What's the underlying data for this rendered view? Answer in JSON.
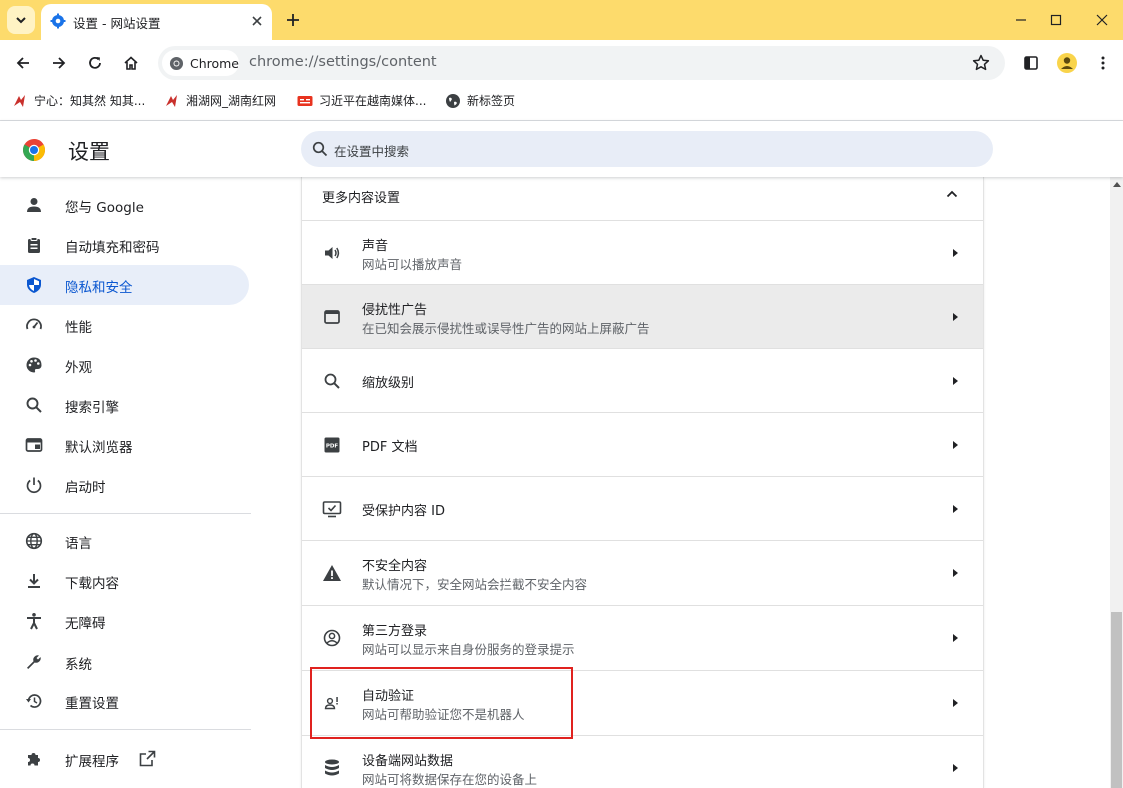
{
  "colors": {
    "tabstrip": "#fddb6c",
    "accent_blue": "#0b57d0",
    "sidebar_active_bg": "#e8eef9",
    "search_bg": "#e8edf7",
    "highlight_red": "#e0221f"
  },
  "tab": {
    "title": "设置 - 网站设置",
    "favicon": "gear-icon"
  },
  "toolbar": {
    "chip_label": "Chrome",
    "url_scheme": "chrome://",
    "url_host": "settings",
    "url_path": "/content"
  },
  "bookmarks": [
    {
      "label": "宁心：知其然 知其...",
      "icon": "red-bookmark-icon"
    },
    {
      "label": "湘湖网_湖南红网",
      "icon": "red-bookmark-icon"
    },
    {
      "label": "习近平在越南媒体...",
      "icon": "toutiao-icon"
    },
    {
      "label": "新标签页",
      "icon": "globe-icon"
    }
  ],
  "header": {
    "title": "设置",
    "search_placeholder": "在设置中搜索"
  },
  "sidebar": {
    "items": [
      {
        "label": "您与 Google",
        "icon": "person-icon"
      },
      {
        "label": "自动填充和密码",
        "icon": "clipboard-icon"
      },
      {
        "label": "隐私和安全",
        "icon": "shield-icon",
        "active": true
      },
      {
        "label": "性能",
        "icon": "speedometer-icon"
      },
      {
        "label": "外观",
        "icon": "palette-icon"
      },
      {
        "label": "搜索引擎",
        "icon": "search-icon"
      },
      {
        "label": "默认浏览器",
        "icon": "browser-icon"
      },
      {
        "label": "启动时",
        "icon": "power-icon"
      },
      {
        "label": "语言",
        "icon": "globe-icon"
      },
      {
        "label": "下载内容",
        "icon": "download-icon"
      },
      {
        "label": "无障碍",
        "icon": "accessibility-icon"
      },
      {
        "label": "系统",
        "icon": "wrench-icon"
      },
      {
        "label": "重置设置",
        "icon": "reset-icon"
      },
      {
        "label": "扩展程序",
        "icon": "puzzle-icon"
      }
    ]
  },
  "content": {
    "section_title": "更多内容设置",
    "rows": [
      {
        "title": "声音",
        "subtitle": "网站可以播放声音",
        "icon": "speaker-icon"
      },
      {
        "title": "侵扰性广告",
        "subtitle": "在已知会展示侵扰性或误导性广告的网站上屏蔽广告",
        "icon": "window-icon"
      },
      {
        "title": "缩放级别",
        "subtitle": "",
        "icon": "search-icon"
      },
      {
        "title": "PDF 文档",
        "subtitle": "",
        "icon": "pdf-icon"
      },
      {
        "title": "受保护内容 ID",
        "subtitle": "",
        "icon": "monitor-check-icon"
      },
      {
        "title": "不安全内容",
        "subtitle": "默认情况下，安全网站会拦截不安全内容",
        "icon": "warning-icon"
      },
      {
        "title": "第三方登录",
        "subtitle": "网站可以显示来自身份服务的登录提示",
        "icon": "account-circle-icon"
      },
      {
        "title": "自动验证",
        "subtitle": "网站可帮助验证您不是机器人",
        "icon": "person-verify-icon"
      },
      {
        "title": "设备端网站数据",
        "subtitle": "网站可将数据保存在您的设备上",
        "icon": "database-icon"
      }
    ]
  }
}
